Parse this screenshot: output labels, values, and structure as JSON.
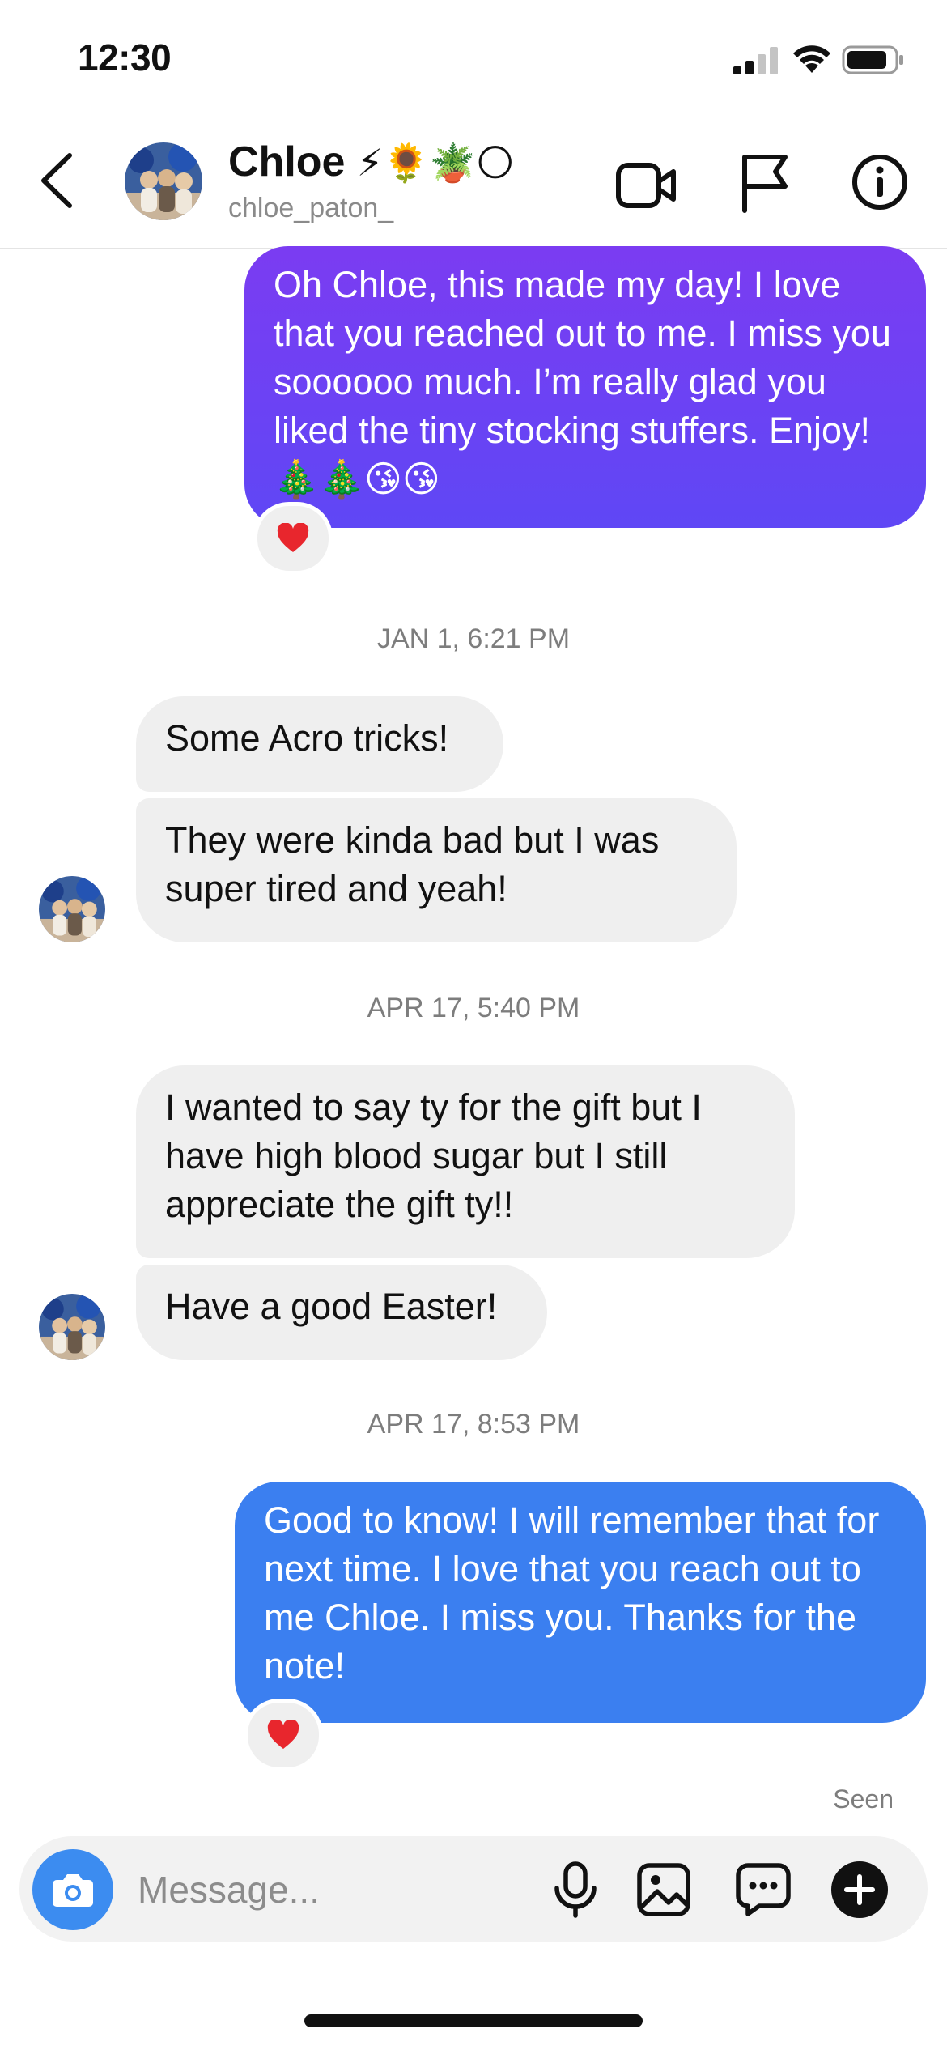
{
  "status_bar": {
    "time": "12:30"
  },
  "header": {
    "name": "Chloe",
    "name_emojis": "⚡🌻🪴🌕",
    "username": "chloe_paton_"
  },
  "messages": [
    {
      "direction": "outgoing",
      "text": "Oh Chloe, this made my day! I love that you reached out to me. I miss you soooooo much. I’m really glad you liked the tiny stocking stuffers. Enjoy! 🎄🎄😘😘",
      "reaction": "heart"
    },
    {
      "divider": "JAN 1, 6:21 PM"
    },
    {
      "direction": "incoming",
      "text": "Some Acro tricks!"
    },
    {
      "direction": "incoming",
      "text": "They were kinda bad but I was super tired and yeah!"
    },
    {
      "divider": "APR 17, 5:40 PM"
    },
    {
      "direction": "incoming",
      "text": "I wanted to say ty for the gift but I have high blood sugar but I still appreciate the gift ty!!"
    },
    {
      "direction": "incoming",
      "text": "Have a good Easter!"
    },
    {
      "divider": "APR 17, 8:53 PM"
    },
    {
      "direction": "outgoing",
      "text": "Good to know! I will remember that for next time. I love that you reach out to me Chloe. I miss you. Thanks for the note!",
      "reaction": "heart"
    }
  ],
  "seen_label": "Seen",
  "composer": {
    "placeholder": "Message..."
  },
  "icons": {
    "back": "chevron-left-icon",
    "video": "video-camera-icon",
    "flag": "flag-icon",
    "info": "info-icon",
    "camera": "camera-icon",
    "mic": "microphone-icon",
    "gallery": "image-icon",
    "sticker": "sticker-chat-icon",
    "plus": "plus-icon",
    "reaction": "heart-icon"
  },
  "colors": {
    "outgoing_bubble_1": "#6c3ff5",
    "outgoing_bubble_2": "#3b7ff0",
    "incoming_bubble": "#efefef",
    "camera_button": "#3c8cf0"
  }
}
